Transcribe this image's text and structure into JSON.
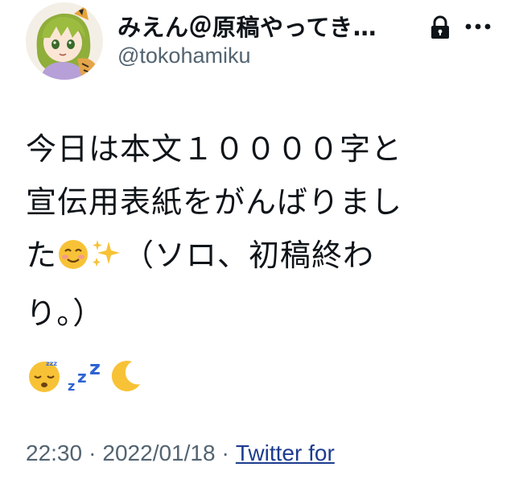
{
  "tweet": {
    "author": {
      "display_name": "みえん＠原稿やってき…",
      "handle": "@tokohamiku",
      "avatar_icon": "anime-avatar",
      "protected_icon": "lock-icon"
    },
    "more_icon": "more-options-icon",
    "text_lines": [
      "今日は本文１００００字と",
      "宣伝用表紙をがんばりまし",
      "た",
      "（ソロ、初稿終わ",
      "り。）"
    ],
    "emojis": {
      "smile": "smiling-face-emoji",
      "sparkles": "sparkles-emoji",
      "sleeping": "sleeping-face-emoji",
      "zzz": "zzz-emoji",
      "moon": "crescent-moon-emoji"
    },
    "time": "22:30",
    "separator": "·",
    "date": "2022/01/18",
    "source": "Twitter for"
  },
  "colors": {
    "text": "#0f1419",
    "secondary": "#536471",
    "link": "#1d3c8f"
  }
}
